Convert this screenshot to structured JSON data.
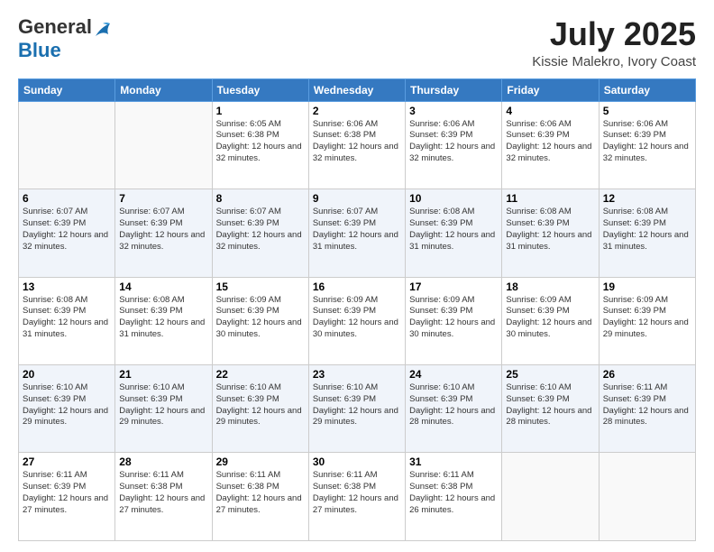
{
  "logo": {
    "general": "General",
    "blue": "Blue"
  },
  "header": {
    "month": "July 2025",
    "location": "Kissie Malekro, Ivory Coast"
  },
  "weekdays": [
    "Sunday",
    "Monday",
    "Tuesday",
    "Wednesday",
    "Thursday",
    "Friday",
    "Saturday"
  ],
  "weeks": [
    [
      {
        "day": null
      },
      {
        "day": null
      },
      {
        "day": "1",
        "sunrise": "6:05 AM",
        "sunset": "6:38 PM",
        "daylight": "12 hours and 32 minutes."
      },
      {
        "day": "2",
        "sunrise": "6:06 AM",
        "sunset": "6:38 PM",
        "daylight": "12 hours and 32 minutes."
      },
      {
        "day": "3",
        "sunrise": "6:06 AM",
        "sunset": "6:39 PM",
        "daylight": "12 hours and 32 minutes."
      },
      {
        "day": "4",
        "sunrise": "6:06 AM",
        "sunset": "6:39 PM",
        "daylight": "12 hours and 32 minutes."
      },
      {
        "day": "5",
        "sunrise": "6:06 AM",
        "sunset": "6:39 PM",
        "daylight": "12 hours and 32 minutes."
      }
    ],
    [
      {
        "day": "6",
        "sunrise": "6:07 AM",
        "sunset": "6:39 PM",
        "daylight": "12 hours and 32 minutes."
      },
      {
        "day": "7",
        "sunrise": "6:07 AM",
        "sunset": "6:39 PM",
        "daylight": "12 hours and 32 minutes."
      },
      {
        "day": "8",
        "sunrise": "6:07 AM",
        "sunset": "6:39 PM",
        "daylight": "12 hours and 32 minutes."
      },
      {
        "day": "9",
        "sunrise": "6:07 AM",
        "sunset": "6:39 PM",
        "daylight": "12 hours and 31 minutes."
      },
      {
        "day": "10",
        "sunrise": "6:08 AM",
        "sunset": "6:39 PM",
        "daylight": "12 hours and 31 minutes."
      },
      {
        "day": "11",
        "sunrise": "6:08 AM",
        "sunset": "6:39 PM",
        "daylight": "12 hours and 31 minutes."
      },
      {
        "day": "12",
        "sunrise": "6:08 AM",
        "sunset": "6:39 PM",
        "daylight": "12 hours and 31 minutes."
      }
    ],
    [
      {
        "day": "13",
        "sunrise": "6:08 AM",
        "sunset": "6:39 PM",
        "daylight": "12 hours and 31 minutes."
      },
      {
        "day": "14",
        "sunrise": "6:08 AM",
        "sunset": "6:39 PM",
        "daylight": "12 hours and 31 minutes."
      },
      {
        "day": "15",
        "sunrise": "6:09 AM",
        "sunset": "6:39 PM",
        "daylight": "12 hours and 30 minutes."
      },
      {
        "day": "16",
        "sunrise": "6:09 AM",
        "sunset": "6:39 PM",
        "daylight": "12 hours and 30 minutes."
      },
      {
        "day": "17",
        "sunrise": "6:09 AM",
        "sunset": "6:39 PM",
        "daylight": "12 hours and 30 minutes."
      },
      {
        "day": "18",
        "sunrise": "6:09 AM",
        "sunset": "6:39 PM",
        "daylight": "12 hours and 30 minutes."
      },
      {
        "day": "19",
        "sunrise": "6:09 AM",
        "sunset": "6:39 PM",
        "daylight": "12 hours and 29 minutes."
      }
    ],
    [
      {
        "day": "20",
        "sunrise": "6:10 AM",
        "sunset": "6:39 PM",
        "daylight": "12 hours and 29 minutes."
      },
      {
        "day": "21",
        "sunrise": "6:10 AM",
        "sunset": "6:39 PM",
        "daylight": "12 hours and 29 minutes."
      },
      {
        "day": "22",
        "sunrise": "6:10 AM",
        "sunset": "6:39 PM",
        "daylight": "12 hours and 29 minutes."
      },
      {
        "day": "23",
        "sunrise": "6:10 AM",
        "sunset": "6:39 PM",
        "daylight": "12 hours and 29 minutes."
      },
      {
        "day": "24",
        "sunrise": "6:10 AM",
        "sunset": "6:39 PM",
        "daylight": "12 hours and 28 minutes."
      },
      {
        "day": "25",
        "sunrise": "6:10 AM",
        "sunset": "6:39 PM",
        "daylight": "12 hours and 28 minutes."
      },
      {
        "day": "26",
        "sunrise": "6:11 AM",
        "sunset": "6:39 PM",
        "daylight": "12 hours and 28 minutes."
      }
    ],
    [
      {
        "day": "27",
        "sunrise": "6:11 AM",
        "sunset": "6:39 PM",
        "daylight": "12 hours and 27 minutes."
      },
      {
        "day": "28",
        "sunrise": "6:11 AM",
        "sunset": "6:38 PM",
        "daylight": "12 hours and 27 minutes."
      },
      {
        "day": "29",
        "sunrise": "6:11 AM",
        "sunset": "6:38 PM",
        "daylight": "12 hours and 27 minutes."
      },
      {
        "day": "30",
        "sunrise": "6:11 AM",
        "sunset": "6:38 PM",
        "daylight": "12 hours and 27 minutes."
      },
      {
        "day": "31",
        "sunrise": "6:11 AM",
        "sunset": "6:38 PM",
        "daylight": "12 hours and 26 minutes."
      },
      {
        "day": null
      },
      {
        "day": null
      }
    ]
  ],
  "labels": {
    "sunrise": "Sunrise:",
    "sunset": "Sunset:",
    "daylight": "Daylight:"
  }
}
